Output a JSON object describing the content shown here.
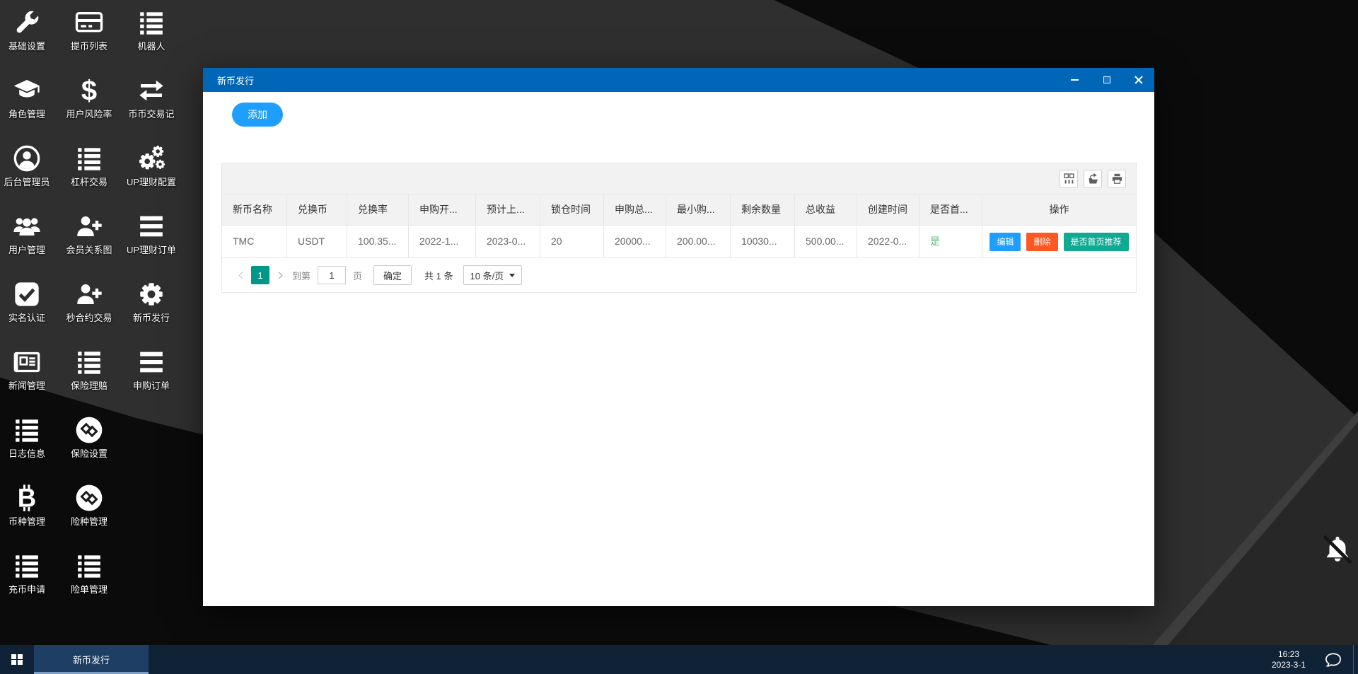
{
  "desktop": {
    "icons": [
      {
        "label": "基础设置",
        "icon": "wrench"
      },
      {
        "label": "提币列表",
        "icon": "card"
      },
      {
        "label": "机器人",
        "icon": "list"
      },
      {
        "label": "角色管理",
        "icon": "cap"
      },
      {
        "label": "用户风险率",
        "icon": "dollar"
      },
      {
        "label": "币币交易记",
        "icon": "exchange"
      },
      {
        "label": "后台管理员",
        "icon": "usercircle"
      },
      {
        "label": "杠杆交易",
        "icon": "list"
      },
      {
        "label": "UP理财配置",
        "icon": "gears"
      },
      {
        "label": "用户管理",
        "icon": "users"
      },
      {
        "label": "会员关系图",
        "icon": "userplus"
      },
      {
        "label": "UP理财订单",
        "icon": "bars"
      },
      {
        "label": "实名认证",
        "icon": "checksq"
      },
      {
        "label": "秒合约交易",
        "icon": "userplus"
      },
      {
        "label": "新币发行",
        "icon": "gear"
      },
      {
        "label": "新闻管理",
        "icon": "news"
      },
      {
        "label": "保险理赔",
        "icon": "list"
      },
      {
        "label": "申购订单",
        "icon": "bars"
      },
      {
        "label": "日志信息",
        "icon": "list"
      },
      {
        "label": "保险设置",
        "icon": "insurance"
      },
      {
        "label": "币种管理",
        "icon": "bitcoin"
      },
      {
        "label": "险种管理",
        "icon": "insurance"
      },
      {
        "label": "充币申请",
        "icon": "list"
      },
      {
        "label": "险单管理",
        "icon": "list"
      }
    ]
  },
  "window": {
    "title": "新币发行",
    "add_button": "添加",
    "toolbar_icons": [
      "filter-columns",
      "export",
      "print"
    ],
    "table": {
      "headers": [
        "新币名称",
        "兑换币",
        "兑换率",
        "申购开...",
        "预计上...",
        "锁仓时间",
        "申购总...",
        "最小购...",
        "剩余数量",
        "总收益",
        "创建时间",
        "是否首...",
        "操作"
      ],
      "rows": [
        {
          "cells": [
            "TMC",
            "USDT",
            "100.35...",
            "2022-1...",
            "2023-0...",
            "20",
            "20000...",
            "200.00...",
            "10030...",
            "500.00...",
            "2022-0...",
            "是"
          ],
          "actions": [
            "编辑",
            "删除",
            "是否首页推荐"
          ]
        }
      ]
    },
    "pagination": {
      "active_page": "1",
      "goto_label": "到第",
      "goto_value": "1",
      "page_label": "页",
      "confirm": "确定",
      "total": "共 1 条",
      "page_size": "10 条/页"
    }
  },
  "taskbar": {
    "active_item": "新币发行",
    "time": "16:23",
    "date": "2023-3-1"
  },
  "colors": {
    "titlebar": "#0067b8",
    "primary_button": "#1e9fff",
    "edit_button": "#1e9fff",
    "delete_button": "#ff5722",
    "recommend_button": "#0faa92",
    "pagination_active": "#009688",
    "success_text": "#5fb878",
    "taskbar": "#0f2236"
  }
}
